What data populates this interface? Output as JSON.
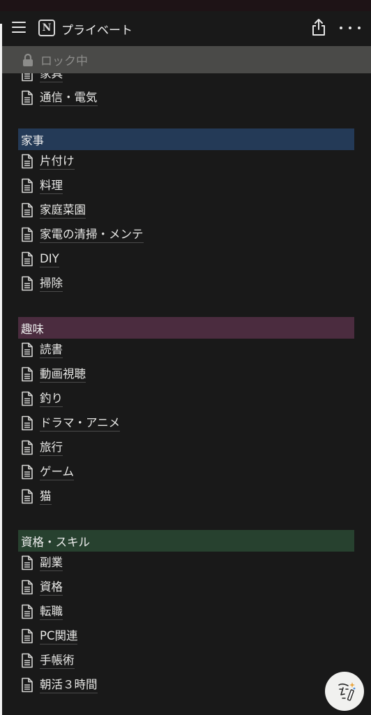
{
  "header": {
    "title": "プライベート",
    "notion_logo": "N"
  },
  "lock_bar": {
    "label": "ロック中"
  },
  "partial_item": {
    "label": "家具"
  },
  "sections": [
    {
      "items": [
        {
          "label": "通信・電気"
        }
      ]
    },
    {
      "title": "家事",
      "color": "#243a57",
      "items": [
        {
          "label": "片付け"
        },
        {
          "label": "料理"
        },
        {
          "label": "家庭菜園"
        },
        {
          "label": "家電の清掃・メンテ"
        },
        {
          "label": "DIY"
        },
        {
          "label": "掃除"
        }
      ]
    },
    {
      "title": "趣味",
      "color": "#4b2c3f",
      "items": [
        {
          "label": "読書"
        },
        {
          "label": "動画視聴"
        },
        {
          "label": "釣り"
        },
        {
          "label": "ドラマ・アニメ"
        },
        {
          "label": "旅行"
        },
        {
          "label": "ゲーム"
        },
        {
          "label": "猫"
        }
      ]
    },
    {
      "title": "資格・スキル",
      "color": "#27412f",
      "items": [
        {
          "label": "副業"
        },
        {
          "label": "資格"
        },
        {
          "label": "転職"
        },
        {
          "label": "PC関連"
        },
        {
          "label": "手帳術"
        },
        {
          "label": "朝活３時間"
        }
      ]
    }
  ],
  "icons": {
    "menu": "hamburger-menu-icon",
    "logo": "notion-logo-icon",
    "share": "share-icon",
    "more": "more-options-icon",
    "lock": "lock-icon",
    "page": "page-icon",
    "ai": "notion-ai-face-icon"
  }
}
